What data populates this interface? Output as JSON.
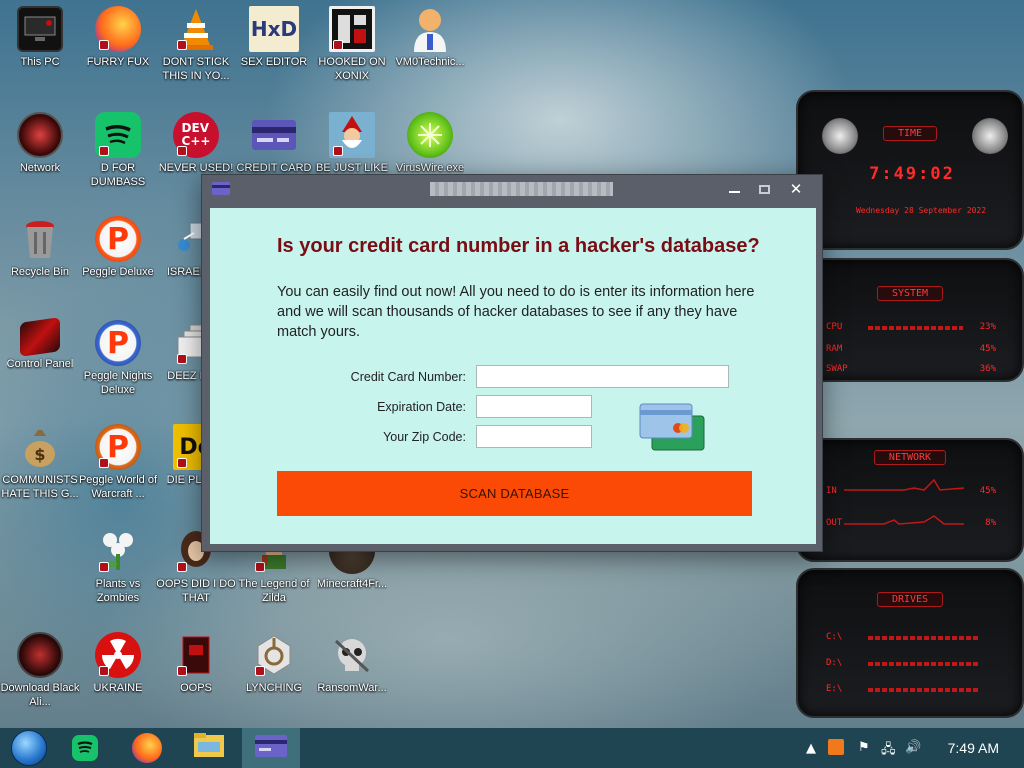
{
  "desktop": {
    "icons": [
      {
        "label": "This PC",
        "icon": "monitor-icon",
        "color": "#1a1a1a"
      },
      {
        "label": "FURRY FUX",
        "icon": "firefox-icon",
        "color": "#ff7a1a"
      },
      {
        "label": "DONT STICK THIS IN YO...",
        "icon": "vlc-cone-icon",
        "color": "#f08a00"
      },
      {
        "label": "SEX EDITOR",
        "icon": "hxd-icon",
        "color": "#e8d9a0"
      },
      {
        "label": "HOOKED ON XONIX",
        "icon": "xonix-icon",
        "color": "#222222"
      },
      {
        "label": "VM0Technic...",
        "icon": "doctor-icon",
        "color": "#f3b26b"
      },
      {
        "label": "Network",
        "icon": "alien-orb-icon",
        "color": "#3a0a0a"
      },
      {
        "label": "D FOR DUMBASS",
        "icon": "spotify-icon",
        "color": "#16c36b"
      },
      {
        "label": "NEVER USED!",
        "icon": "devcpp-icon",
        "color": "#c8102e"
      },
      {
        "label": "CREDIT CARD CHECKER",
        "icon": "credit-card-icon",
        "color": "#5c56b8"
      },
      {
        "label": "BE JUST LIKE THE DUDE!",
        "icon": "gnome-icon",
        "color": "#4aa0c8"
      },
      {
        "label": "VirusWire.exe",
        "icon": "lime-icon",
        "color": "#62c21a"
      },
      {
        "label": "Recycle Bin",
        "icon": "recycle-bin-icon",
        "color": "#7a1a1a"
      },
      {
        "label": "Peggle Deluxe",
        "icon": "peggle-icon",
        "color": "#ff5a1a"
      },
      {
        "label": "ISRAEL S...",
        "icon": "network-share-icon",
        "color": "#6a9ac8"
      },
      {
        "label": "Control Panel",
        "icon": "control-panel-icon",
        "color": "#b01010"
      },
      {
        "label": "Peggle Nights Deluxe",
        "icon": "peggle-nights-icon",
        "color": "#3a6ad0"
      },
      {
        "label": "DEEZ NU...",
        "icon": "windows-stack-icon",
        "color": "#9a9a9a"
      },
      {
        "label": "COMMUNISTS HATE THIS G...",
        "icon": "money-bag-icon",
        "color": "#c8a060"
      },
      {
        "label": "Peggle World of Warcraft ...",
        "icon": "peggle-wow-icon",
        "color": "#e06a1a"
      },
      {
        "label": "DIE PLEA...",
        "icon": "die-icon",
        "color": "#f0c000"
      },
      {
        "label": "Plants vs Zombies",
        "icon": "plant-icon",
        "color": "#e8e8e8"
      },
      {
        "label": "OOPS DID I DO THAT",
        "icon": "portrait-icon",
        "color": "#5a3a2a"
      },
      {
        "label": "The Legend of Zilda",
        "icon": "zelda-icon",
        "color": "#3a6a2a"
      },
      {
        "label": "Minecraft4Fr...",
        "icon": "minecraft-icon",
        "color": "#4a3a2a"
      },
      {
        "label": "Download Black Ali...",
        "icon": "alien-orb-dark-icon",
        "color": "#3a0a0a"
      },
      {
        "label": "UKRAINE",
        "icon": "radiation-icon",
        "color": "#d81010"
      },
      {
        "label": "OOPS",
        "icon": "red-book-icon",
        "color": "#5a1a1a"
      },
      {
        "label": "LYNCHING",
        "icon": "noose-icon",
        "color": "#d8d8d8"
      },
      {
        "label": "RansomWar...",
        "icon": "skull-icon",
        "color": "#c8c8c8"
      }
    ]
  },
  "dialog": {
    "heading": "Is your credit card number in a hacker's database?",
    "intro": "You can easily find out now! All you need to do is enter its information here and we will scan thousands of hacker databases to see if any they have match yours.",
    "fields": {
      "card_label": "Credit Card Number:",
      "card_value": "",
      "exp_label": "Expiration Date:",
      "exp_value": "",
      "zip_label": "Your Zip Code:",
      "zip_value": ""
    },
    "scan_button": "SCAN DATABASE",
    "colors": {
      "accent": "#fa4a05",
      "heading": "#7a0c14",
      "content_bg": "#c8f4ee"
    }
  },
  "widget": {
    "time_tag": "TIME",
    "time": "7:49:02",
    "date": "Wednesday 28 September 2022",
    "system_tag": "SYSTEM",
    "cpu_label": "CPU",
    "cpu_value": "23%",
    "ram_label": "RAM",
    "ram_value": "45%",
    "swap_label": "SWAP",
    "swap_value": "36%",
    "network_tag": "NETWORK",
    "in_label": "IN",
    "in_value": "45%",
    "out_label": "OUT",
    "out_value": "8%",
    "drives_tag": "DRIVES",
    "drives": [
      "C:\\",
      "D:\\",
      "E:\\"
    ]
  },
  "taskbar": {
    "clock": "7:49 AM",
    "items": [
      "start-orb-icon",
      "spotify-icon",
      "firefox-icon",
      "file-explorer-icon",
      "credit-card-icon"
    ]
  }
}
